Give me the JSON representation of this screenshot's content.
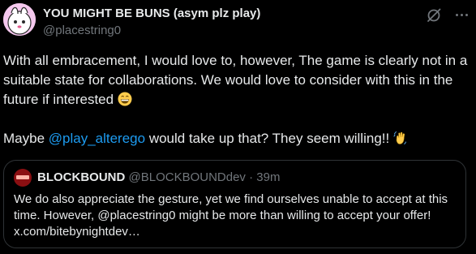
{
  "post": {
    "author": {
      "display_name": "YOU MIGHT BE BUNS (asym plz play)",
      "handle": "@placestring0"
    },
    "paragraph1": "With all embracement, I would love to, however, The game is clearly not in a suitable state for collaborations. We would love to consider with this in the future if interested",
    "paragraph2_before": "Maybe ",
    "mention": "@play_alterego",
    "paragraph2_after": " would take up that? They seem willing!! ",
    "emojis": [
      "grinning-face-emoji",
      "waving-hand-emoji"
    ]
  },
  "quote": {
    "display_name": "BLOCKBOUND",
    "handle": "@BLOCKBOUNDdev",
    "separator": " · ",
    "time": "39m",
    "text": "We do also appreciate the gesture, yet we find ourselves unable to accept at this time. However, @placestring0 might be more than willing to accept your offer! x.com/bitebynightdev…"
  },
  "icons": [
    "grok-icon",
    "more-options-icon"
  ],
  "colors": {
    "background": "#000000",
    "text": "#e7e9ea",
    "secondary_text": "#71767b",
    "link": "#1d9bf0",
    "border": "#2f3336"
  }
}
